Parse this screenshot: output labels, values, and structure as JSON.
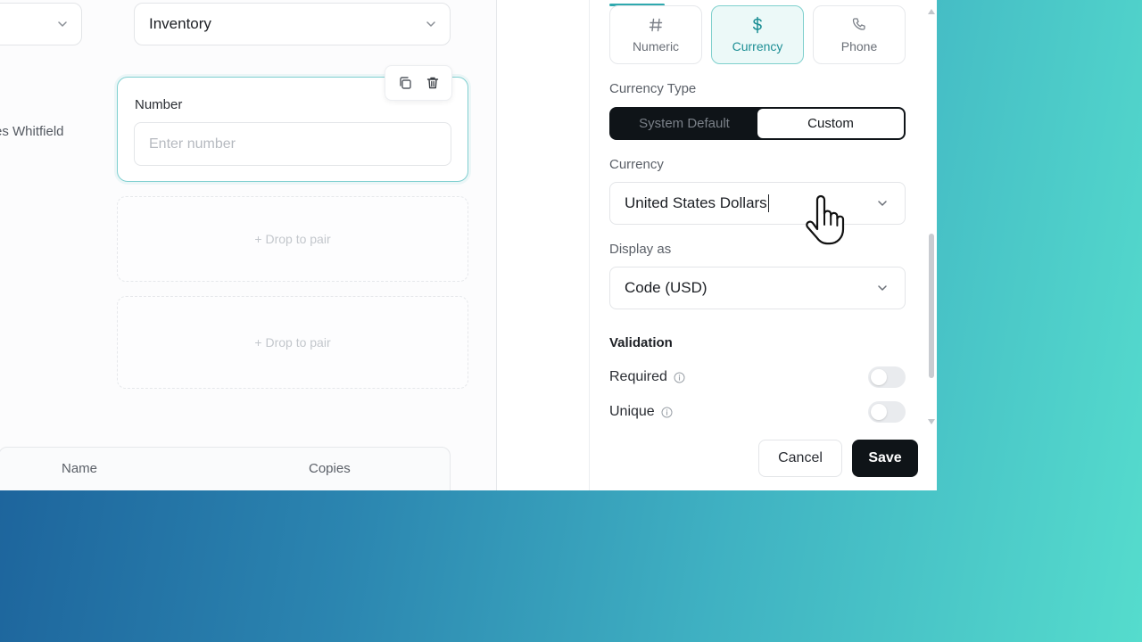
{
  "canvas": {
    "top_select": {
      "value": ""
    },
    "category_select": {
      "value": "Inventory"
    },
    "owner_partial": "es Whitfield",
    "number_field": {
      "label": "Number",
      "placeholder": "Enter number"
    },
    "drop_zones": [
      "+ Drop to pair",
      "+ Drop to pair"
    ],
    "table": {
      "columns": [
        "Name",
        "Copies"
      ]
    }
  },
  "panel": {
    "field_types": [
      {
        "label": "Numeric",
        "icon": "hash-icon"
      },
      {
        "label": "Currency",
        "icon": "dollar-icon",
        "active": true
      },
      {
        "label": "Phone",
        "icon": "phone-icon"
      }
    ],
    "currency_type": {
      "label": "Currency Type",
      "options": [
        "System Default",
        "Custom"
      ],
      "selected": "Custom"
    },
    "currency": {
      "label": "Currency",
      "value": "United States Dollars"
    },
    "display_as": {
      "label": "Display as",
      "value": "Code (USD)"
    },
    "validation": {
      "title": "Validation",
      "rules": [
        {
          "label": "Required",
          "enabled": false
        },
        {
          "label": "Unique",
          "enabled": false
        }
      ]
    },
    "actions": {
      "cancel": "Cancel",
      "save": "Save"
    }
  },
  "colors": {
    "accent": "#2fa9ae",
    "accent_bg": "#ecf9f8",
    "primary_dark": "#0f1418"
  }
}
